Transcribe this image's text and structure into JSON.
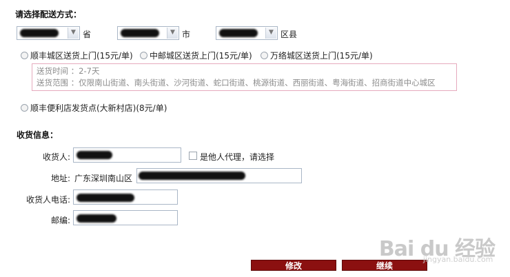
{
  "delivery": {
    "title": "请选择配送方式：",
    "region": {
      "province_suffix": "省",
      "city_suffix": "市",
      "district_suffix": "区县"
    },
    "options": [
      {
        "label": "顺丰城区送货上门(15元/单)"
      },
      {
        "label": "中邮城区送货上门(15元/单)"
      },
      {
        "label": "万络城区送货上门(15元/单)"
      }
    ],
    "info": {
      "time_line": "送货时间 ：2-7天",
      "range_line": "送货范围 ：仅限南山街道、南头街道、沙河街道、蛇口街道、桃源街道、西丽街道、粤海街道、招商街道中心城区"
    },
    "pickup_option": "顺丰便利店发货点(大新村店)(8元/单)"
  },
  "receiver": {
    "title": "收货信息：",
    "name_label": "收货人:",
    "proxy_checkbox_label": "是他人代理，请选择",
    "address_label": "地址:",
    "address_prefix": "广东深圳南山区",
    "phone_label": "收货人电话:",
    "postcode_label": "邮编:"
  },
  "buttons": {
    "modify": "修改",
    "continue": "继续"
  },
  "watermark": {
    "brand": "Bai du 经验",
    "url": "jingyan.baidu.com"
  },
  "colors": {
    "button_bg": "#8b1010",
    "info_border": "#e6a9bd",
    "info_text": "#8b8b8b"
  }
}
